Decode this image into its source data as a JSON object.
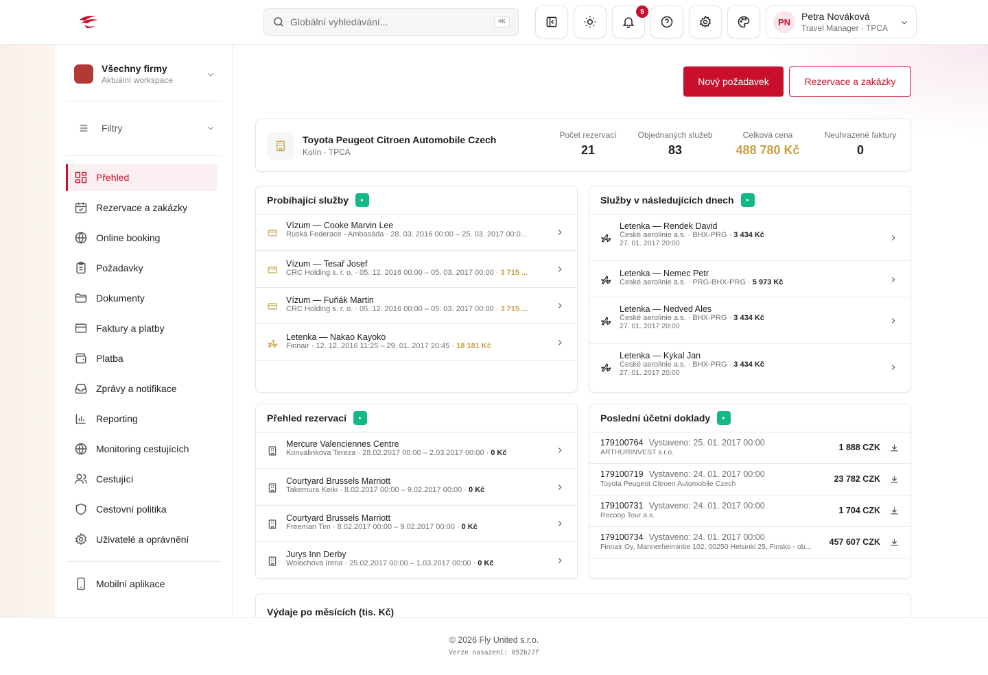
{
  "search": {
    "placeholder": "Globální vyhledávání...",
    "shortcut": "⌘K"
  },
  "notifications": {
    "count": "5"
  },
  "user": {
    "initials": "PN",
    "name": "Petra Nováková",
    "role": "Travel Manager · TPCA"
  },
  "workspace": {
    "title": "Všechny firmy",
    "subtitle": "Aktuální workspace"
  },
  "filters": {
    "label": "Filtry"
  },
  "nav": [
    {
      "label": "Přehled",
      "icon": "dashboard-icon",
      "active": true
    },
    {
      "label": "Rezervace a zakázky",
      "icon": "calendar-check-icon"
    },
    {
      "label": "Online booking",
      "icon": "globe-icon"
    },
    {
      "label": "Požadavky",
      "icon": "clipboard-icon"
    },
    {
      "label": "Dokumenty",
      "icon": "folder-icon"
    },
    {
      "label": "Faktury a platby",
      "icon": "credit-card-icon"
    },
    {
      "label": "Platba",
      "icon": "wallet-icon"
    },
    {
      "label": "Zprávy a notifikace",
      "icon": "inbox-icon"
    },
    {
      "label": "Reporting",
      "icon": "bar-chart-icon"
    },
    {
      "label": "Monitoring cestujících",
      "icon": "globe-icon"
    },
    {
      "label": "Cestující",
      "icon": "users-icon"
    },
    {
      "label": "Cestovní politika",
      "icon": "shield-icon"
    },
    {
      "label": "Uživatelé a oprávnění",
      "icon": "gear-icon"
    }
  ],
  "mobile": {
    "label": "Mobilní aplikace"
  },
  "actions": {
    "new_request": "Nový požadavek",
    "reservations": "Rezervace a zakázky"
  },
  "company": {
    "name": "Toyota Peugeot Citroen Automobile Czech",
    "sub": "Kolín · TPCA",
    "stats": [
      {
        "label": "Počet rezervací",
        "value": "21"
      },
      {
        "label": "Objednaných služeb",
        "value": "83"
      },
      {
        "label": "Celková cena",
        "value": "488 780 Kč"
      },
      {
        "label": "Neuhrazené faktury",
        "value": "0"
      }
    ]
  },
  "ongoing": {
    "title": "Probíhající služby",
    "rows": [
      {
        "icon": "card-icon",
        "title": "Vízum — Cooke Marvin Lee",
        "sub": "Ruská Federace - Ambasáda · 28. 03. 2016 00:00 – 25. 03. 2017 00:0...",
        "amount": ""
      },
      {
        "icon": "card-icon",
        "title": "Vízum — Tesař Josef",
        "sub": "CRC Holding s. r. o. · 05. 12. 2016 00:00 – 05. 03. 2017 00:00 · ",
        "amount": "3 715 ..."
      },
      {
        "icon": "card-icon",
        "title": "Vízum — Fuňák Martin",
        "sub": "CRC Holding s. r. o. · 05. 12. 2016 00:00 – 05. 03. 2017 00:00 · ",
        "amount": "3 715 ..."
      },
      {
        "icon": "plane-icon",
        "title": "Letenka — Nakao Kayoko",
        "sub": "Finnair · 12. 12. 2016 11:25 – 29. 01. 2017 20:45 · ",
        "amount": "18 181 Kč"
      }
    ]
  },
  "upcoming": {
    "title": "Služby v následujících dnech",
    "rows": [
      {
        "title": "Letenka — Rendek David",
        "sub": "České aerolinie a.s. · BHX-PRG · ",
        "amount": "3 434 Kč",
        "date": "27. 01. 2017 20:00"
      },
      {
        "title": "Letenka — Nemec Petr",
        "sub": "České aerolinie a.s. · PRG-BHX-PRG · ",
        "amount": "5 973 Kč",
        "date": ""
      },
      {
        "title": "Letenka — Nedved Ales",
        "sub": "České aerolinie a.s. · BHX-PRG · ",
        "amount": "3 434 Kč",
        "date": "27. 01. 2017 20:00"
      },
      {
        "title": "Letenka — Kykal Jan",
        "sub": "České aerolinie a.s. · BHX-PRG · ",
        "amount": "3 434 Kč",
        "date": "27. 01. 2017 20:00"
      }
    ]
  },
  "reservations": {
    "title": "Přehled rezervací",
    "rows": [
      {
        "title": "Mercure Valenciennes Centre",
        "sub": "Konvalinkova Tereza · 28.02.2017 00:00 – 2.03.2017 00:00 · ",
        "amount": "0 Kč"
      },
      {
        "title": "Courtyard Brussels Marriott",
        "sub": "Takemura Keiki · 8.02.2017 00:00 – 9.02.2017 00:00 · ",
        "amount": "0 Kč"
      },
      {
        "title": "Courtyard Brussels Marriott",
        "sub": "Freeman Tim · 8.02.2017 00:00 – 9.02.2017 00:00 · ",
        "amount": "0 Kč"
      },
      {
        "title": "Jurys Inn Derby",
        "sub": "Wolochova Irena · 25.02.2017 00:00 – 1.03.2017 00:00 · ",
        "amount": "0 Kč"
      }
    ]
  },
  "documents": {
    "title": "Poslední účetní doklady",
    "rows": [
      {
        "number": "179100764",
        "issued": "Vystaveno: 25. 01. 2017 00:00",
        "client": "ARTHURINVEST s.r.o.",
        "amount": "1 888 CZK"
      },
      {
        "number": "179100719",
        "issued": "Vystaveno: 24. 01. 2017 00:00",
        "client": "Toyota Peugeot Citroen Automobile Czech",
        "amount": "23 782 CZK"
      },
      {
        "number": "179100731",
        "issued": "Vystaveno: 24. 01. 2017 00:00",
        "client": "Recoop Tour a.s.",
        "amount": "1 704 CZK"
      },
      {
        "number": "179100734",
        "issued": "Vystaveno: 24. 01. 2017 00:00",
        "client": "Finnair Oy, Mannerheimintie 102, 00250 Helsinki 25, Finsko - ob...",
        "amount": "457 607 CZK"
      }
    ]
  },
  "expenses": {
    "title": "Výdaje po měsících (tis. Kč)"
  },
  "footer": {
    "copyright": "© 2026 Fly United s.r.o.",
    "version": "Verze nasazení: 052b27f"
  },
  "colors": {
    "brand": "#c8102e",
    "gold": "#c8a046",
    "success": "#12b886"
  }
}
